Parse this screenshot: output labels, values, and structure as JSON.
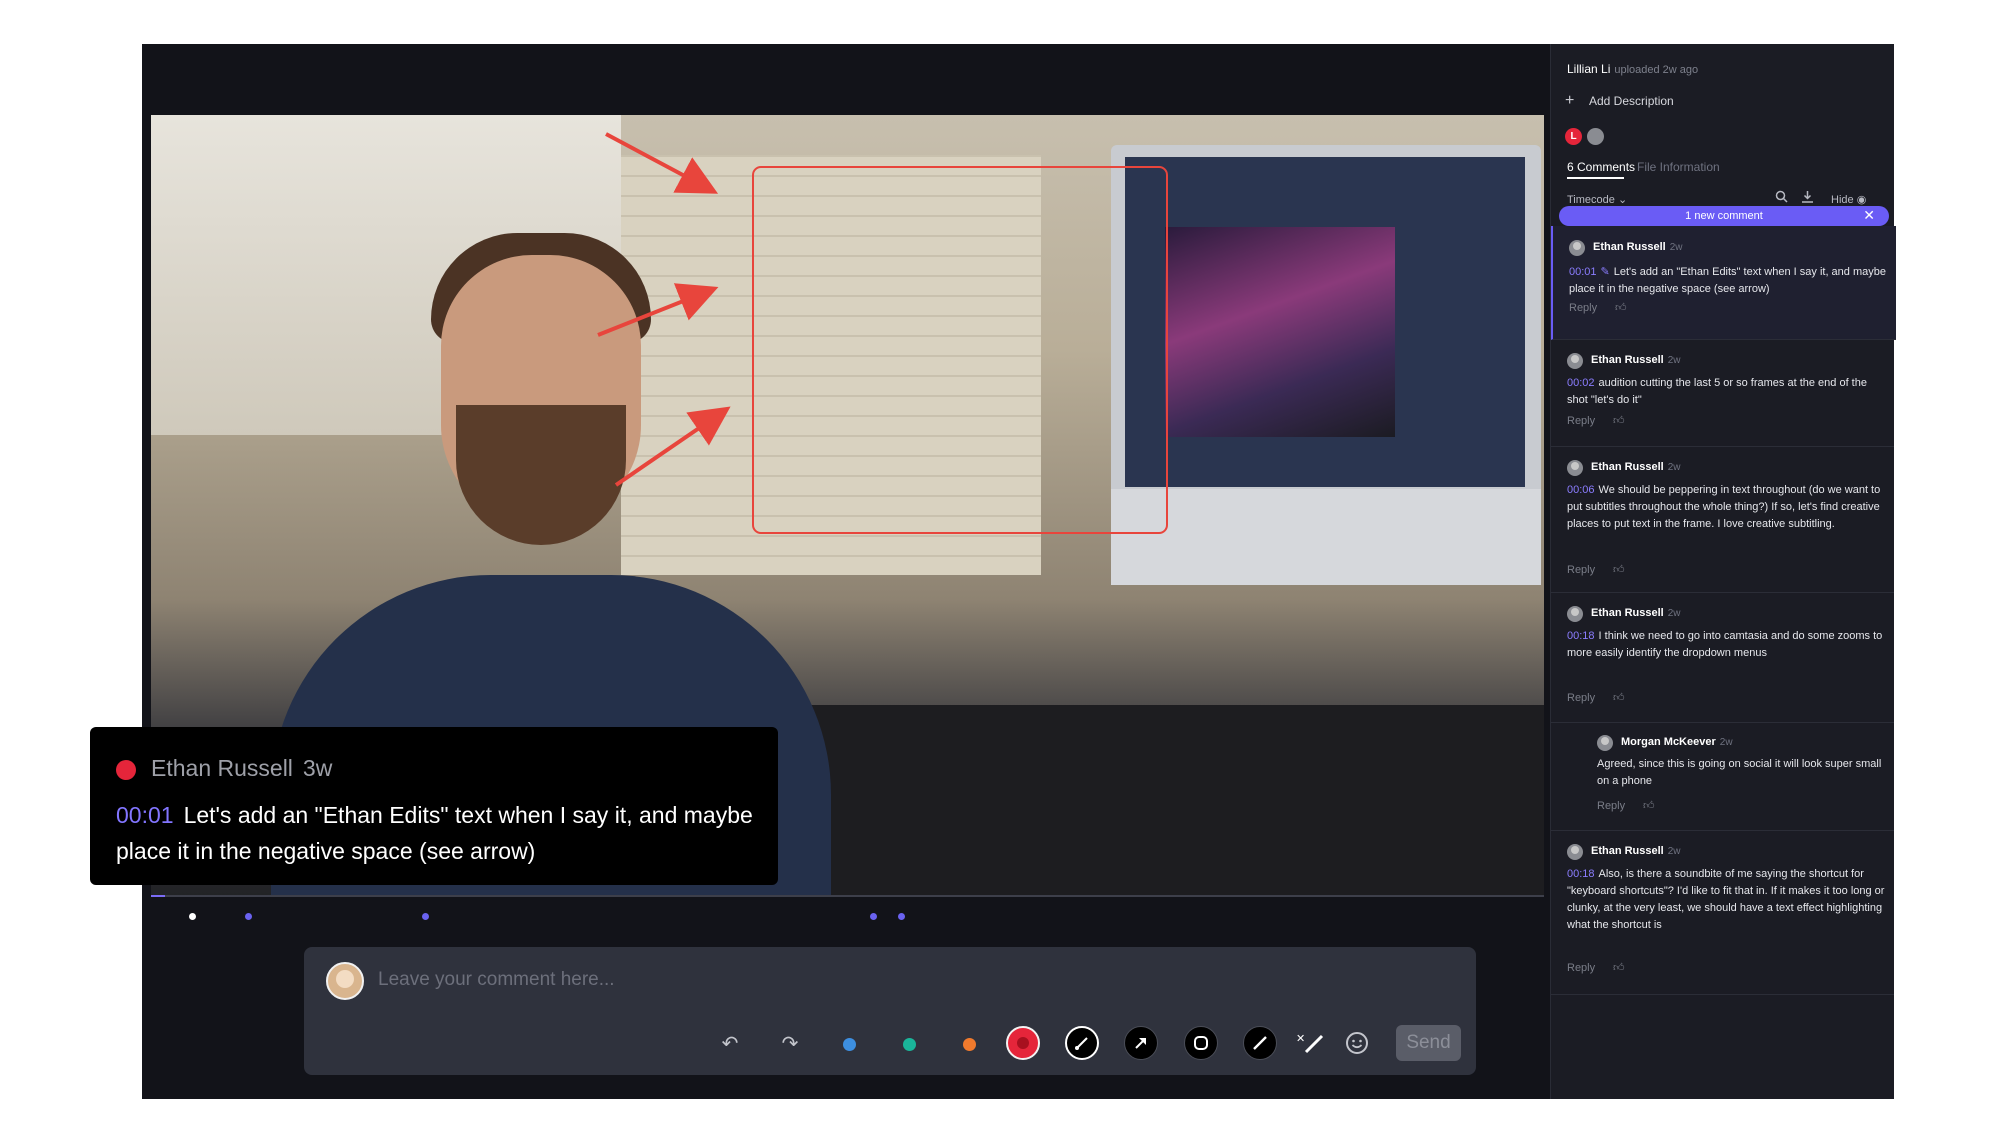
{
  "caption": {
    "author": "Ethan Russell",
    "ago": "3w",
    "timecode": "00:01",
    "text": "Let's add an \"Ethan Edits\" text when I say it, and maybe place it in the negative space (see arrow)"
  },
  "composer": {
    "placeholder": "Leave your comment here...",
    "send_label": "Send",
    "tools": [
      "undo-icon",
      "redo-icon",
      "color-blue",
      "color-green",
      "color-orange",
      "color-red",
      "brush-icon",
      "arrow-icon",
      "rectangle-icon",
      "line-icon",
      "clear-drawing-icon",
      "emoji-icon"
    ],
    "colors": {
      "blue": "#3d8fe0",
      "green": "#1ab59a",
      "orange": "#f07a2d",
      "red": "#e5253a"
    }
  },
  "sidebar": {
    "uploader_name": "Lillian Li",
    "uploader_meta": "uploaded 2w ago",
    "add_description": "Add Description",
    "avatars": [
      {
        "initial": "L",
        "color": "#e5253a"
      },
      {
        "initial": "",
        "color": "#8a8c92"
      }
    ],
    "tabs": {
      "comments": "6 Comments",
      "file_info": "File Information"
    },
    "sort": "Timecode ⌄",
    "hide": "Hide",
    "new_comment_banner": "1 new comment",
    "reply_label": "Reply",
    "comments": [
      {
        "author": "Ethan Russell",
        "ago": "2w",
        "timecode": "00:01",
        "text": "Let's add an \"Ethan Edits\" text when I say it, and maybe place it in the negative space (see arrow)",
        "has_drawing": true
      },
      {
        "author": "Ethan Russell",
        "ago": "2w",
        "timecode": "00:02",
        "text": "audition cutting the last 5 or so frames at the end of the shot \"let's do it\""
      },
      {
        "author": "Ethan Russell",
        "ago": "2w",
        "timecode": "00:06",
        "text": "We should be peppering in text throughout (do we want to put subtitles throughout the whole thing?) If so, let's find creative places to put text in the frame. I love creative subtitling."
      },
      {
        "author": "Ethan Russell",
        "ago": "2w",
        "timecode": "00:18",
        "text": "I think we need to go into camtasia and do some zooms to more easily identify the dropdown menus"
      },
      {
        "author": "Morgan McKeever",
        "ago": "2w",
        "timecode": "",
        "text": "Agreed, since this is going on social it will look super small on a phone",
        "is_reply": true
      },
      {
        "author": "Ethan Russell",
        "ago": "2w",
        "timecode": "00:18",
        "text": "Also, is there a soundbite of me saying the shortcut for \"keyboard shortcuts\"? I'd like to fit that in. If it makes it too long or clunky, at the very least, we should have a text effect highlighting what the shortcut is"
      }
    ]
  },
  "player": {
    "progress": 0.01,
    "marker_timecodes": [
      "00:01",
      "00:02",
      "00:06",
      "00:18",
      "00:18"
    ]
  }
}
